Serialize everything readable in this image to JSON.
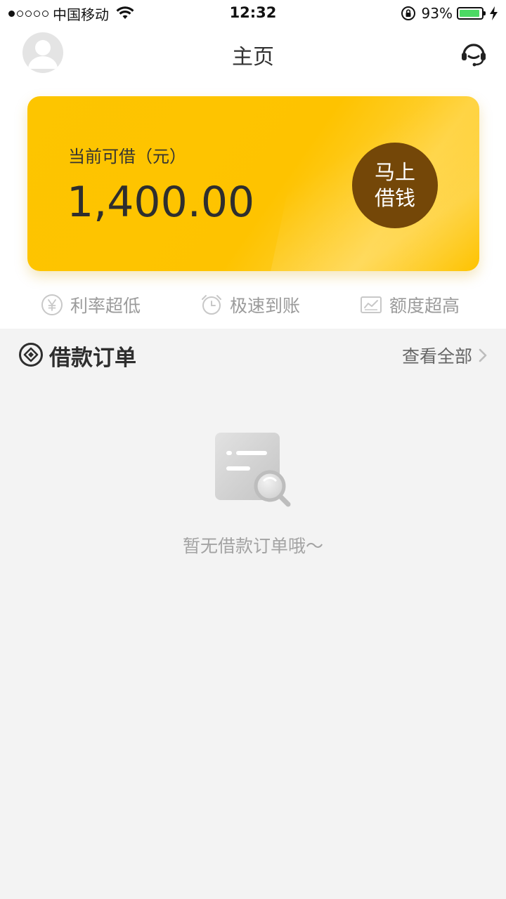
{
  "status_bar": {
    "carrier": "中国移动",
    "time": "12:32",
    "battery_percent": "93%",
    "battery_level": 0.93,
    "signal_bars_filled": 1,
    "signal_bars_total": 5
  },
  "nav": {
    "title": "主页",
    "avatar_icon": "user-avatar-icon",
    "service_icon": "customer-service-headset-icon"
  },
  "loan_card": {
    "label": "当前可借（元）",
    "amount": "1,400.00",
    "button_line1": "马上",
    "button_line2": "借钱",
    "card_color": "#FEC300",
    "button_color": "#744708"
  },
  "features": [
    {
      "icon": "yen-circle-icon",
      "label": "利率超低"
    },
    {
      "icon": "alarm-clock-icon",
      "label": "极速到账"
    },
    {
      "icon": "chart-line-icon",
      "label": "额度超高"
    }
  ],
  "orders": {
    "title": "借款订单",
    "view_all": "查看全部",
    "empty_text": "暂无借款订单哦～"
  }
}
